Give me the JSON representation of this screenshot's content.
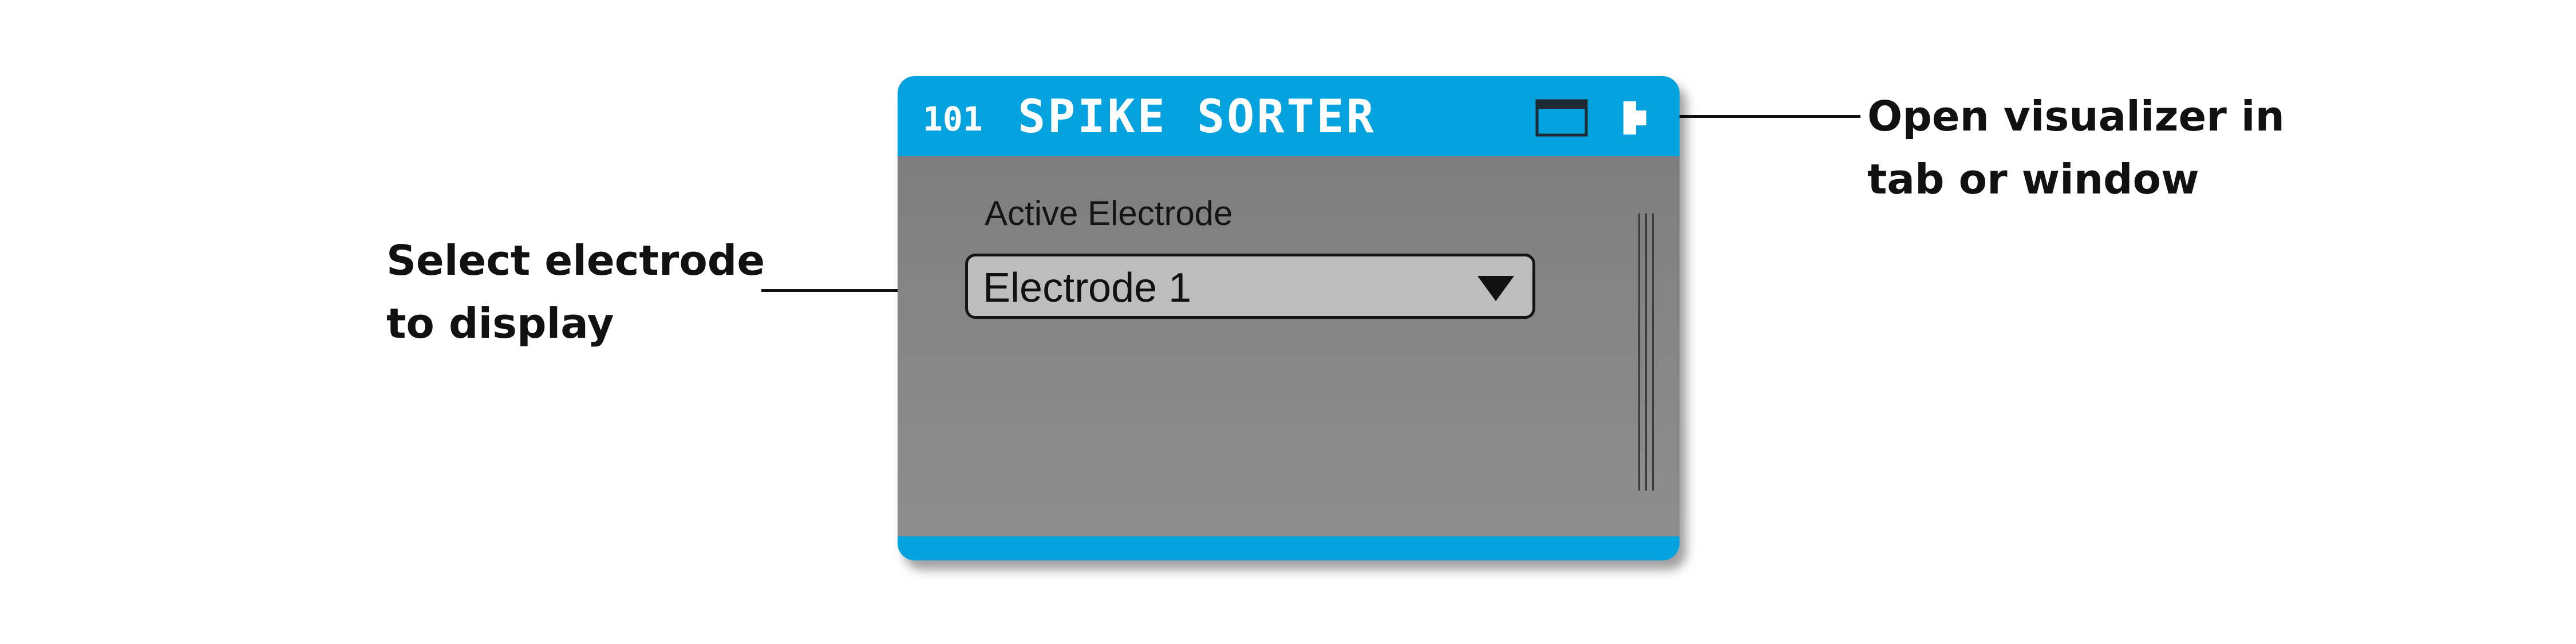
{
  "callouts": {
    "left": {
      "line1": "Select electrode",
      "line2": "to display"
    },
    "right": {
      "line1": "Open visualizer in",
      "line2": "tab or window"
    }
  },
  "node": {
    "id": "101",
    "name": "SPIKE SORTER",
    "header_color": "#04A3E0",
    "body_color": "#858585",
    "icons": {
      "tab": "tab-window-icon",
      "window": "window-icon"
    },
    "active_electrode": {
      "label": "Active Electrode",
      "selected": "Electrode 1"
    }
  }
}
